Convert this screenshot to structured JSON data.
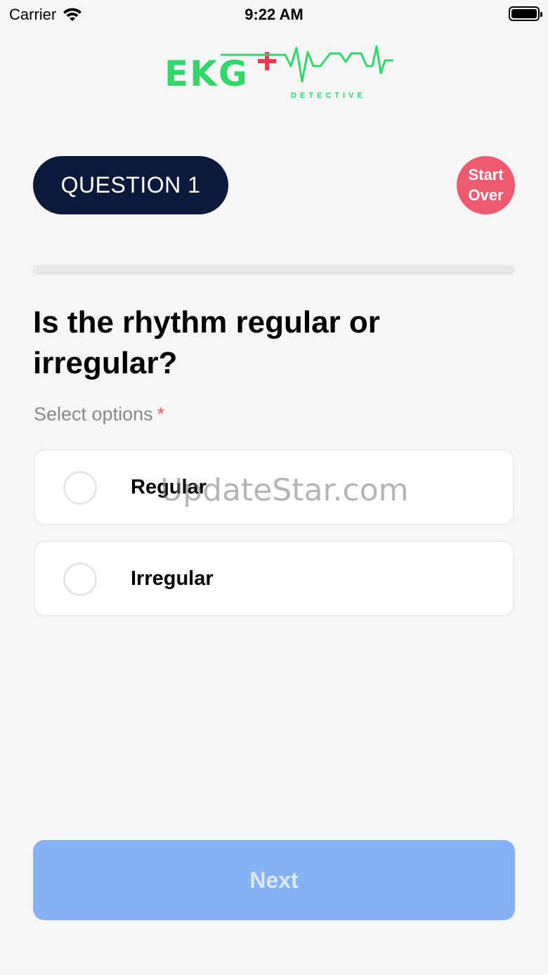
{
  "status_bar": {
    "carrier": "Carrier",
    "time": "9:22 AM",
    "battery_level": 1.0
  },
  "logo": {
    "main_text": "EKG",
    "sub_text": "DETECTIVE",
    "color": "#2fd86b"
  },
  "header": {
    "question_label": "QUESTION 1",
    "start_over_line1": "Start",
    "start_over_line2": "Over"
  },
  "progress": {
    "fraction": 0.0
  },
  "question": {
    "text": "Is the rhythm regular or irregular?",
    "select_label": "Select options",
    "required_marker": "*"
  },
  "options": [
    {
      "label": "Regular",
      "selected": false
    },
    {
      "label": "Irregular",
      "selected": false
    }
  ],
  "watermark": "UpdateStar.com",
  "footer": {
    "next_label": "Next"
  },
  "colors": {
    "pill_bg": "#0b1a3b",
    "start_over_bg": "#ee5a6f",
    "next_bg_disabled": "#86b2f5",
    "background": "#f6f6f6"
  }
}
